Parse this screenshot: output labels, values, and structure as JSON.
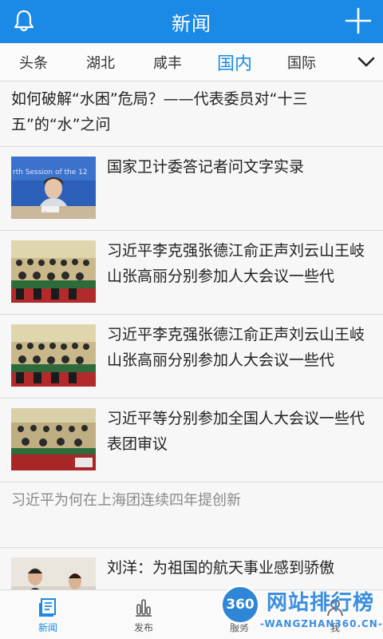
{
  "header": {
    "title": "新闻",
    "left_icon": "bell-icon",
    "right_icon": "plus-icon",
    "color": "#1a8ae6"
  },
  "tabs": {
    "items": [
      "头条",
      "湖北",
      "咸丰",
      "国内",
      "国际"
    ],
    "active": "国内",
    "more_icon": "chevron-down-icon"
  },
  "news": [
    {
      "title": "如何破解“水困”危局？——代表委员对“十三五”的“水”之问"
    },
    {
      "title": "国家卫计委答记者问文字实录",
      "thumb_caption": "rth Session of the 12"
    },
    {
      "title": "习近平李克强张德江俞正声刘云山王岐山张高丽分别参加人大会议一些代"
    },
    {
      "title": "习近平李克强张德江俞正声刘云山王岐山张高丽分别参加人大会议一些代"
    },
    {
      "title": "习近平等分别参加全国人大会议一些代表团审议"
    },
    {
      "title": "习近平为何在上海团连续四年提创新"
    },
    {
      "title": "刘洋：为祖国的航天事业感到骄傲"
    }
  ],
  "bottom_nav": [
    {
      "label": "新闻",
      "icon": "news-icon",
      "active": true
    },
    {
      "label": "发布",
      "icon": "chart-bars-icon",
      "active": false
    },
    {
      "label": "服务",
      "icon": "service-icon",
      "active": false
    },
    {
      "label": "我",
      "icon": "user-icon",
      "active": false
    }
  ],
  "watermark": {
    "logo": "360",
    "text": "网站排行榜",
    "sub": "-WANGZHAN360.CN-"
  }
}
